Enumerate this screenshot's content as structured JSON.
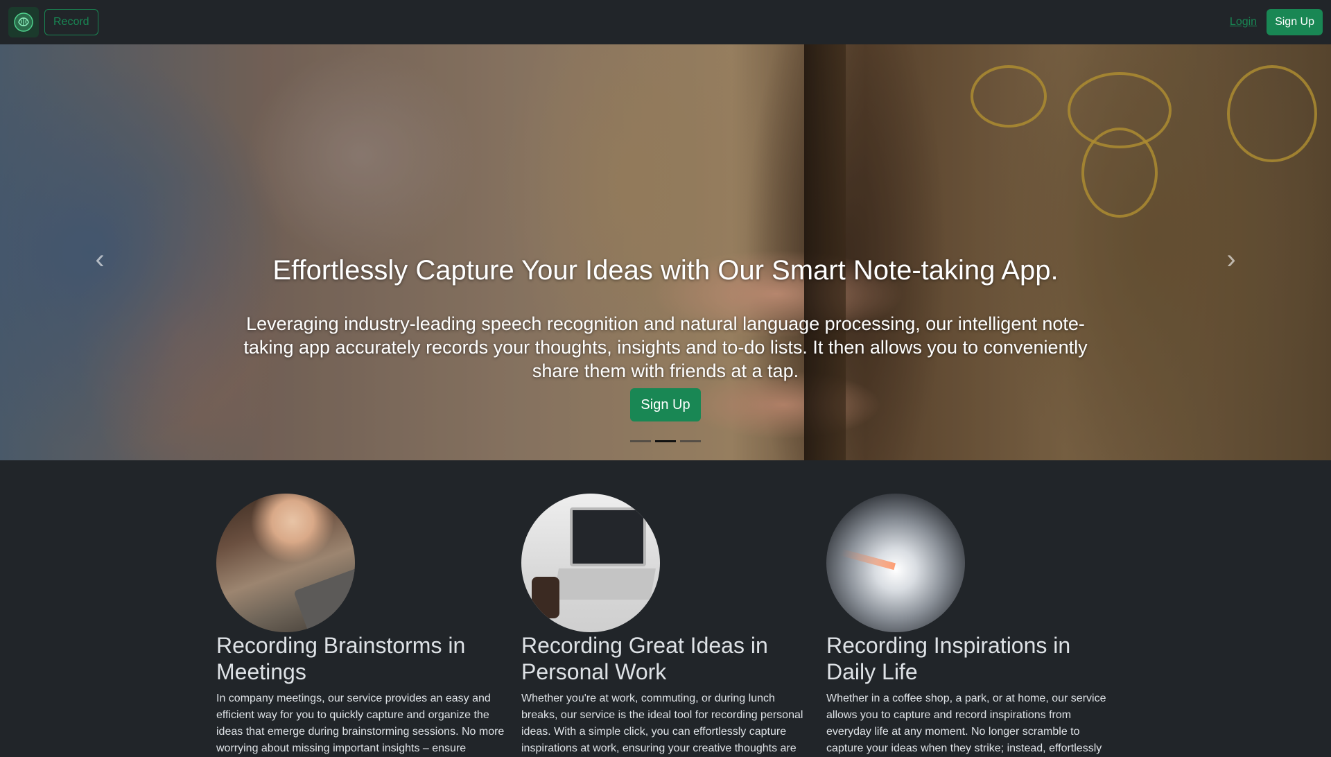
{
  "navbar": {
    "record_label": "Record",
    "login_label": "Login",
    "signup_label": "Sign Up",
    "accent_color": "#198754"
  },
  "hero": {
    "title": "Effortlessly Capture Your Ideas with Our Smart Note-taking App.",
    "text": "Leveraging industry-leading speech recognition and natural language processing, our intelligent note-taking app accurately records your thoughts, insights and to-do lists. It then allows you to conveniently share them with friends at a tap.",
    "signup_label": "Sign Up",
    "slides_count": 3,
    "active_slide": 2,
    "prev_icon": "chevron-left-icon",
    "next_icon": "chevron-right-icon"
  },
  "features": [
    {
      "title": "Recording Brainstorms in Meetings",
      "text": "In company meetings, our service provides an easy and efficient way for you to quickly capture and organize the ideas that emerge during brainstorming sessions. No more worrying about missing important insights – ensure"
    },
    {
      "title": "Recording Great Ideas in Personal Work",
      "text": "Whether you're at work, commuting, or during lunch breaks, our service is the ideal tool for recording personal ideas. With a simple click, you can effortlessly capture inspirations at work, ensuring your creative thoughts are"
    },
    {
      "title": "Recording Inspirations in Daily Life",
      "text": "Whether in a coffee shop, a park, or at home, our service allows you to capture and record inspirations from everyday life at any moment. No longer scramble to capture your ideas when they strike; instead, effortlessly"
    }
  ]
}
